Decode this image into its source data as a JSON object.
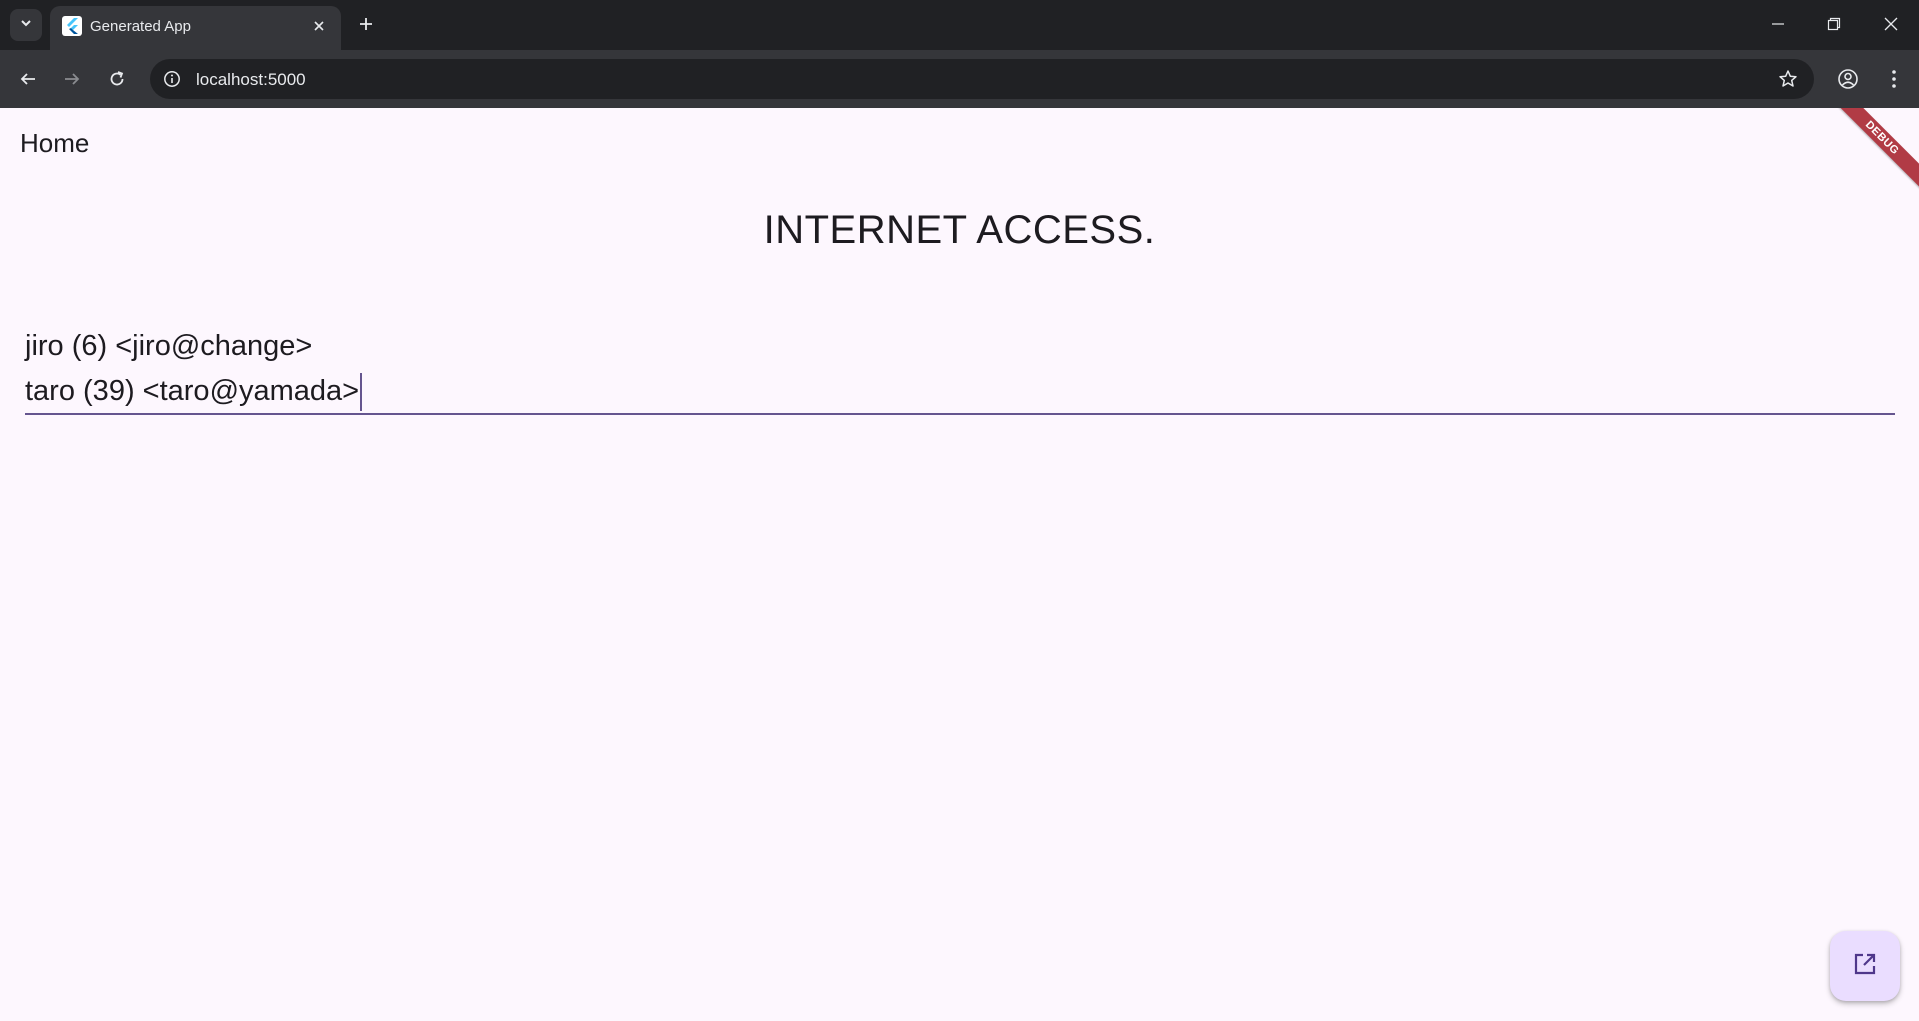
{
  "browser": {
    "tab_title": "Generated App",
    "url": "localhost:5000"
  },
  "app": {
    "appbar_title": "Home",
    "headline": "INTERNET ACCESS.",
    "text_lines": [
      "jiro (6) <jiro@change>",
      "taro (39) <taro@yamada>"
    ],
    "debug_banner": "DEBUG"
  },
  "colors": {
    "page_background": "#fdf7fe",
    "accent": "#65558f",
    "fab_background": "#eaddff",
    "debug_banner": "#b13b45"
  },
  "icons": {
    "fab": "open-in-new-icon"
  }
}
